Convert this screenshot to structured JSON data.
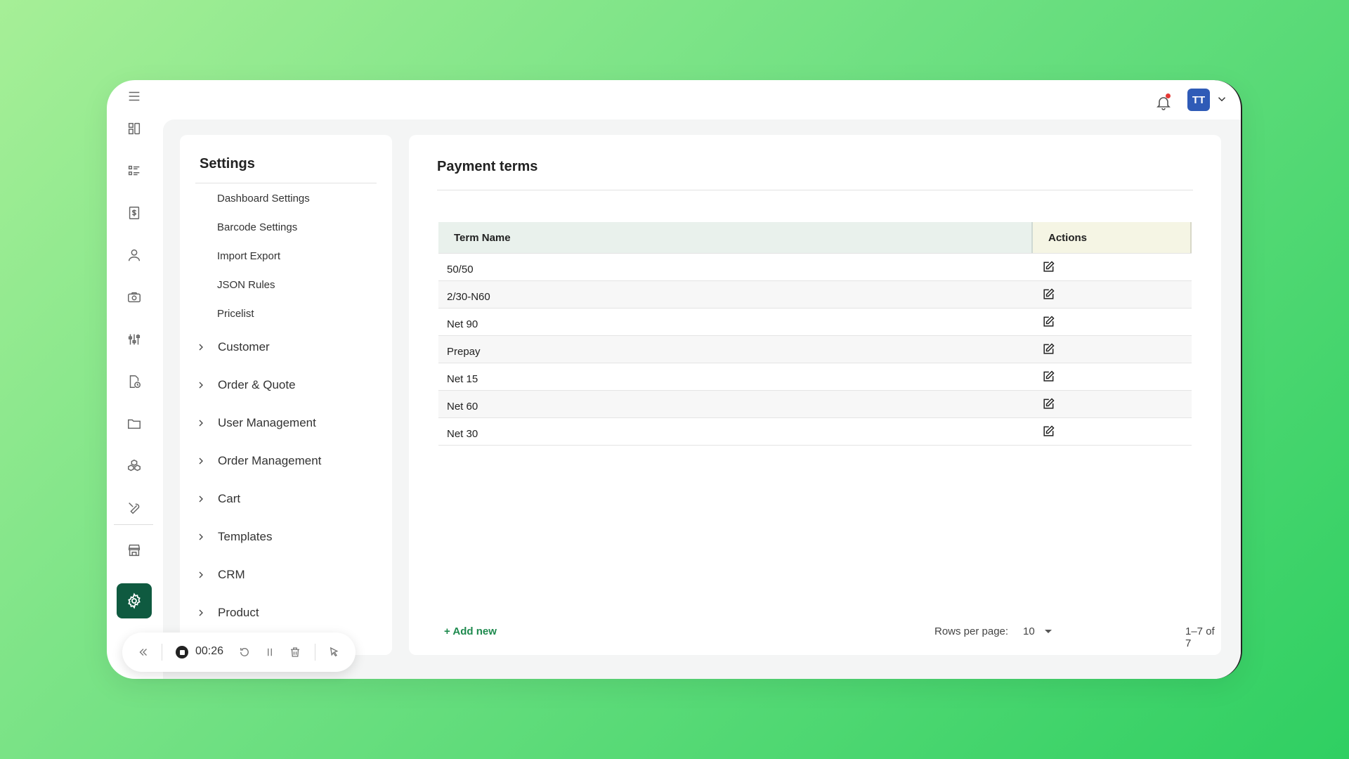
{
  "user": {
    "initials": "TT"
  },
  "settings": {
    "title": "Settings",
    "sub_items": [
      "Dashboard Settings",
      "Barcode Settings",
      "Import Export",
      "JSON Rules",
      "Pricelist"
    ],
    "groups": [
      "Customer",
      "Order & Quote",
      "User Management",
      "Order Management",
      "Cart",
      "Templates",
      "CRM",
      "Product"
    ]
  },
  "main": {
    "title": "Payment terms",
    "columns": {
      "name": "Term Name",
      "actions": "Actions"
    },
    "rows": [
      "50/50",
      "2/30-N60",
      "Net 90",
      "Prepay",
      "Net 15",
      "Net 60",
      "Net 30"
    ],
    "add_new": "+ Add new",
    "rows_per_page_label": "Rows per page:",
    "rows_per_page_value": "10",
    "range": "1–7 of 7"
  },
  "recorder": {
    "time": "00:26"
  },
  "colors": {
    "accent": "#0f5a40",
    "add_new": "#1e8a4e",
    "avatar": "#2f5bb7"
  },
  "icons": {
    "rail": [
      "menu-icon",
      "dashboard-icon",
      "list-icon",
      "invoice-icon",
      "user-icon",
      "camera-icon",
      "sliders-icon",
      "document-clock-icon",
      "folder-icon",
      "boxes-icon",
      "tools-icon",
      "store-icon",
      "gear-icon"
    ],
    "row_action": "edit-icon"
  }
}
